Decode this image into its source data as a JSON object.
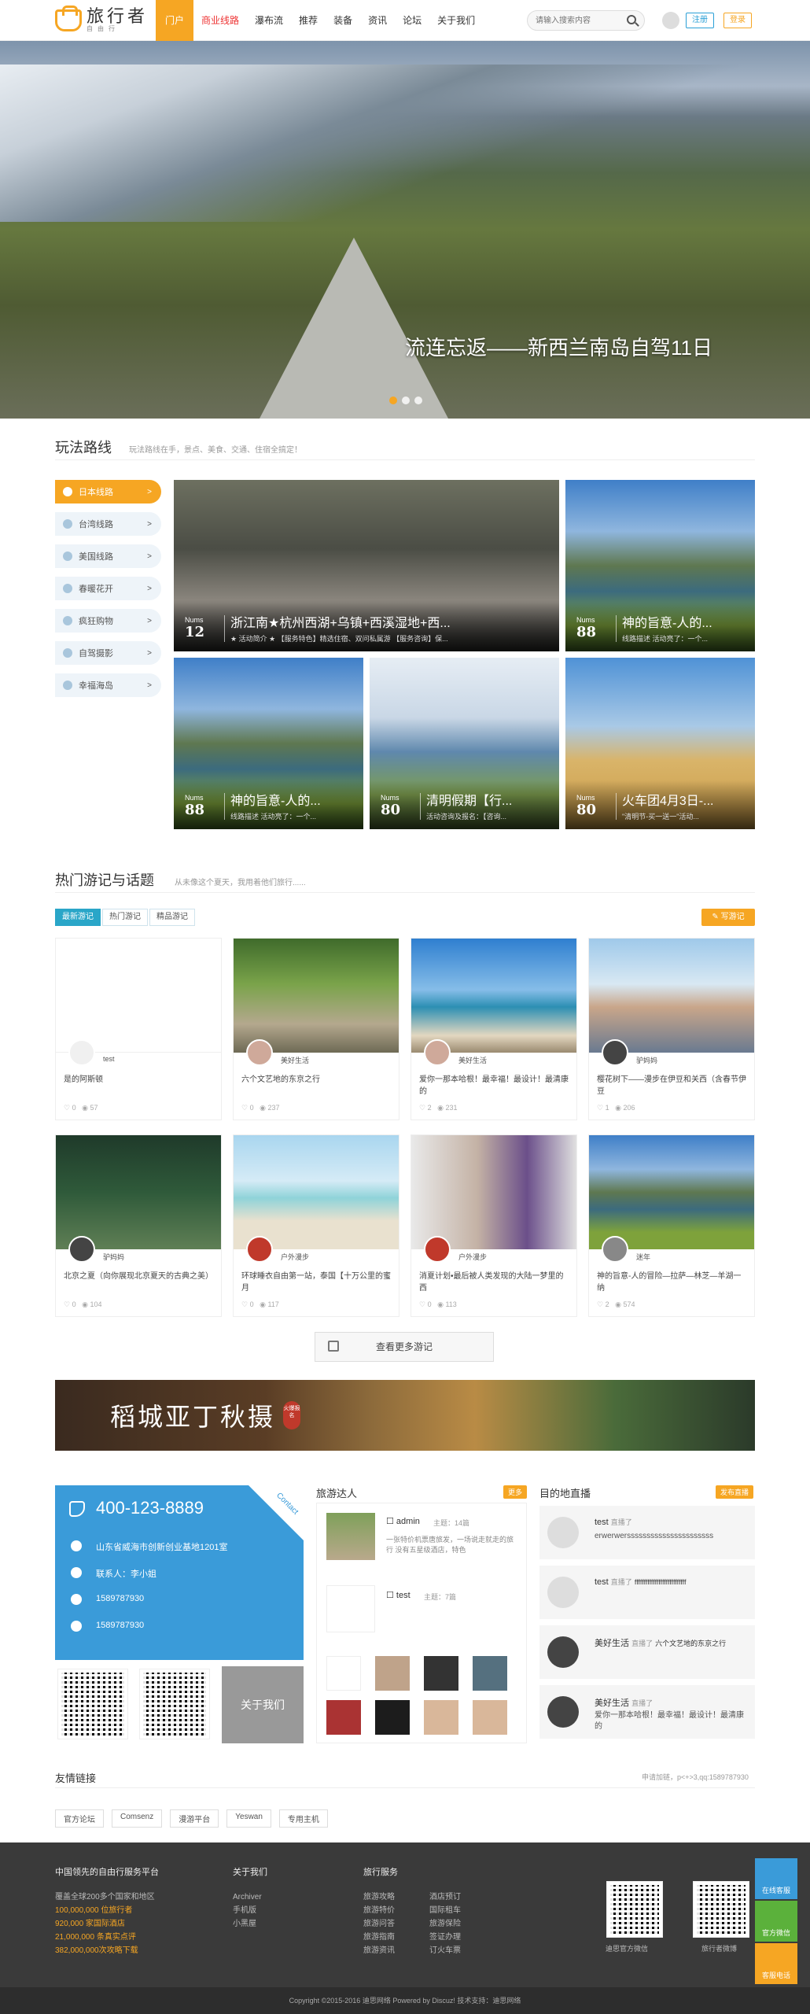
{
  "header": {
    "logo_text": "旅行者",
    "logo_sub": "自由行",
    "nav": [
      "门户",
      "商业线路",
      "瀑布流",
      "推荐",
      "装备",
      "资讯",
      "论坛",
      "关于我们"
    ],
    "search_placeholder": "请输入搜索内容",
    "register": "注册",
    "login": "登录"
  },
  "hero": {
    "title": "流连忘返——新西兰南岛自驾11日",
    "slides": 3,
    "active_slide": 1
  },
  "routes": {
    "title": "玩法路线",
    "subtitle": "玩法路线在手，景点、美食、交通、住宿全搞定！",
    "categories": [
      "日本线路",
      "台湾线路",
      "美国线路",
      "春暖花开",
      "疯狂购物",
      "自驾摄影",
      "幸福海岛"
    ],
    "cards": [
      {
        "nums_label": "Nums",
        "num": "12",
        "title": "浙江南★杭州西湖+乌镇+西溪湿地+西...",
        "desc": "★ 活动简介 ★ 【服务特色】精选住宿、双问私属游 【服务咨询】保..."
      },
      {
        "nums_label": "Nums",
        "num": "88",
        "title": "神的旨意-人的...",
        "desc": "线路描述 活动亮了：一个..."
      },
      {
        "nums_label": "Nums",
        "num": "88",
        "title": "神的旨意-人的...",
        "desc": "线路描述 活动亮了：一个..."
      },
      {
        "nums_label": "Nums",
        "num": "80",
        "title": "清明假期【行...",
        "desc": "活动咨询及报名：【咨询..."
      },
      {
        "nums_label": "Nums",
        "num": "80",
        "title": "火车团4月3日-...",
        "desc": "\"清明节-买一送一\"活动..."
      }
    ]
  },
  "travel": {
    "title": "热门游记与话题",
    "subtitle": "从未像这个夏天，我用着他们旅行......",
    "tabs": [
      "最新游记",
      "热门游记",
      "精品游记"
    ],
    "write": "写游记",
    "cards": [
      {
        "author": "test",
        "title": "是的阿斯顿",
        "likes": "0",
        "views": "57"
      },
      {
        "author": "美好生活",
        "title": "六个文艺地的东京之行",
        "likes": "0",
        "views": "237"
      },
      {
        "author": "美好生活",
        "title": "爱你一那本哈根！最幸福！最设计！最清康的",
        "likes": "2",
        "views": "231"
      },
      {
        "author": "驴妈妈",
        "title": "樱花树下——漫步在伊豆和关西（含春节伊豆",
        "likes": "1",
        "views": "206"
      },
      {
        "author": "驴妈妈",
        "title": "北京之夏（向你展现北京夏天的古典之美）",
        "likes": "0",
        "views": "104"
      },
      {
        "author": "户外漫步",
        "title": "环球睡衣自由第一站，泰国【十万公里的蜜月",
        "likes": "0",
        "views": "117"
      },
      {
        "author": "户外漫步",
        "title": "消夏计划•最后被人类发现的大陆一梦里的西",
        "likes": "0",
        "views": "113"
      },
      {
        "author": "迷年",
        "title": "神的旨意-人的冒险—拉萨—林芝—羊湖一纳",
        "likes": "2",
        "views": "574"
      }
    ],
    "more": "查看更多游记"
  },
  "banner": {
    "title": "稻城亚丁秋摄",
    "badge": "火爆报名"
  },
  "contact": {
    "tag": "Contact",
    "phone": "400-123-8889",
    "address": "山东省威海市创新创业基地1201室",
    "person": "联系人：李小姐",
    "qq1": "1589787930",
    "qq2": "1589787930",
    "about": "关于我们"
  },
  "talents": {
    "title": "旅游达人",
    "more": "更多",
    "user1": "admin",
    "topics1": "主题：14篇",
    "desc1": "一张特价机票唐旅发，一场说走就走的旅行 没有五星级酒店，特色",
    "user2": "test",
    "topics2": "主题：7篇"
  },
  "live": {
    "title": "目的地直播",
    "post": "发布直播",
    "items": [
      {
        "name": "test",
        "action": "直播了",
        "text": "erwerwerssssssssssssssssssssss"
      },
      {
        "name": "test",
        "action": "直播了",
        "text": "ffffffffffffffffffffffffffff"
      },
      {
        "name": "美好生活",
        "action": "直播了",
        "text": "六个文艺地的东京之行"
      },
      {
        "name": "美好生活",
        "action": "直播了",
        "text": "爱你一那本哈根！最幸福！最设计！最清康的"
      }
    ]
  },
  "links": {
    "title": "友情链接",
    "apply": "申请加链，p<+>3,qq:1589787930",
    "items": [
      "官方论坛",
      "Comsenz",
      "漫游平台",
      "Yeswan",
      "专用主机"
    ]
  },
  "footer": {
    "col1_title": "中国领先的自由行服务平台",
    "col1_lines": [
      "覆盖全球200多个国家和地区",
      "100,000,000 位旅行者",
      "920,000 家国际酒店",
      "21,000,000 条真实点评",
      "382,000,000次攻略下载"
    ],
    "col2_title": "关于我们",
    "col2_lines": [
      "Archiver",
      "手机版",
      "小黑屋"
    ],
    "col3_title": "旅行服务",
    "col3a": [
      "旅游攻略",
      "旅游特价",
      "旅游问答",
      "旅游指南",
      "旅游资讯"
    ],
    "col3b": [
      "酒店预订",
      "国际租车",
      "旅游保险",
      "签证办理",
      "订火车票"
    ],
    "qr1": "迪思官方微信",
    "qr2": "旅行者微博",
    "copyright": "Copyright ©2015-2016 迪思网络 Powered by Discuz! 技术支持：迪思网络"
  },
  "side": [
    "在线客服",
    "官方微信",
    "客服电话"
  ]
}
